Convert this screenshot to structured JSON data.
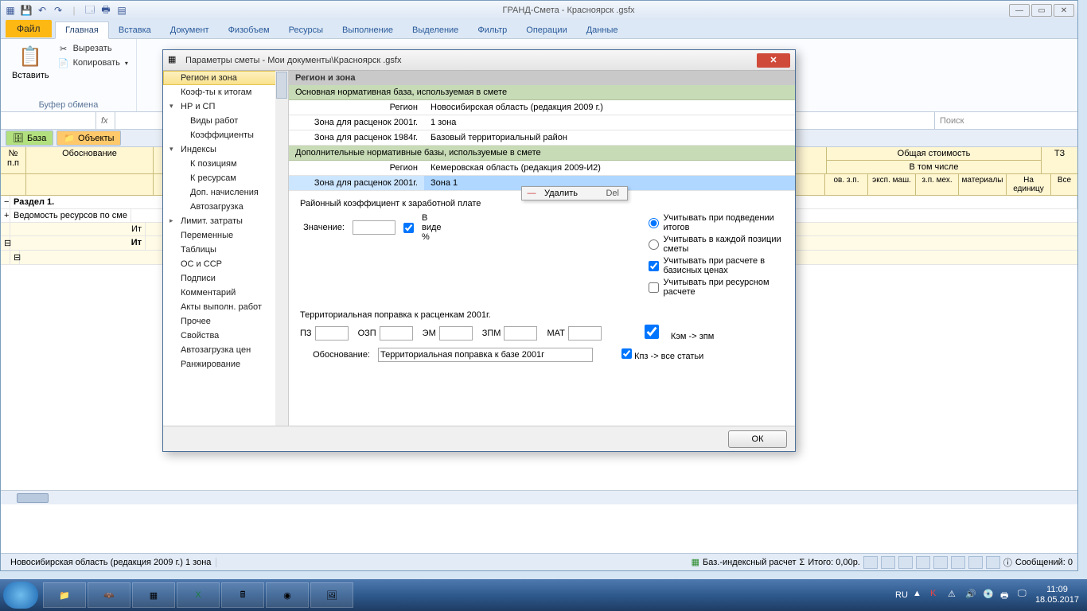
{
  "window": {
    "title": "ГРАНД-Смета - Красноярск .gsfx"
  },
  "file_tab": "Файл",
  "ribbon_tabs": [
    "Главная",
    "Вставка",
    "Документ",
    "Физобъем",
    "Ресурсы",
    "Выполнение",
    "Выделение",
    "Фильтр",
    "Операции",
    "Данные"
  ],
  "clipboard": {
    "paste": "Вставить",
    "cut": "Вырезать",
    "copy": "Копировать",
    "group": "Буфер обмена"
  },
  "search_placeholder": "Поиск",
  "toolbar2": {
    "base": "База",
    "objects": "Объекты"
  },
  "grid": {
    "cols": {
      "num": "№\nп.п",
      "obosn": "Обоснование",
      "total_cost": "Общая стоимость",
      "incl": "В том числе",
      "tz": "ТЗ",
      "na_ed": "На\nединицу",
      "vse": "Все",
      "subcols": [
        "ов. з.п.",
        "эксп. маш.",
        "з.п. мех.",
        "материалы"
      ]
    },
    "section": "Раздел 1.",
    "vedomost": "Ведомость ресурсов по сме",
    "it": "Ит",
    "ito": "Ит"
  },
  "status": {
    "region": "Новосибирская область (редакция 2009 г.)  1 зона",
    "calc": "Баз.-индексный расчет",
    "itogo": "Итого: 0,00р.",
    "msg": "Сообщений: 0"
  },
  "dialog": {
    "title": "Параметры сметы - Мои документы\\Красноярск .gsfx",
    "nav": [
      "Регион и зона",
      "Коэф-ты к итогам",
      "НР и СП",
      "Виды работ",
      "Коэффициенты",
      "Индексы",
      "К позициям",
      "К ресурсам",
      "Доп. начисления",
      "Автозагрузка",
      "Лимит. затраты",
      "Переменные",
      "Таблицы",
      "ОС и ССР",
      "Подписи",
      "Комментарий",
      "Акты выполн. работ",
      "Прочее",
      "Свойства",
      "Автозагрузка цен",
      "Ранжирование"
    ],
    "content_hdr": "Регион и зона",
    "groups": [
      "Основная нормативная база, используемая в смете",
      "Дополнительные нормативные базы, используемые в смете"
    ],
    "rows": {
      "r1k": "Регион",
      "r1v": "Новосибирская область (редакция 2009 г.)",
      "r2k": "Зона для расценок 2001г.",
      "r2v": "1 зона",
      "r3k": "Зона для расценок 1984г.",
      "r3v": "Базовый территориальный район",
      "r4k": "Регион",
      "r4v": "Кемеровская область (редакция 2009-И2)",
      "r5k": "Зона для расценок 2001г.",
      "r5v": "Зона 1"
    },
    "ctx": {
      "delete": "Удалить",
      "del": "Del"
    },
    "coef_title": "Районный коэффициент к заработной плате",
    "value_label": "Значение:",
    "percent": "В виде %",
    "opts": [
      "Учитывать при подведении итогов",
      "Учитывать в каждой позиции сметы",
      "Учитывать при расчете в базисных ценах",
      "Учитывать при ресурсном расчете"
    ],
    "terr_title": "Территориальная поправка к расценкам 2001г.",
    "terr_labels": [
      "ПЗ",
      "ОЗП",
      "ЭМ",
      "ЗПМ",
      "МАТ"
    ],
    "side_checks": [
      "Кэм -> зпм",
      "Кпз -> все статьи"
    ],
    "obosn_label": "Обоснование:",
    "obosn_value": "Территориальная поправка к базе 2001г",
    "ok": "ОК"
  },
  "tray": {
    "lang": "RU",
    "time": "11:09",
    "date": "18.05.2017"
  }
}
